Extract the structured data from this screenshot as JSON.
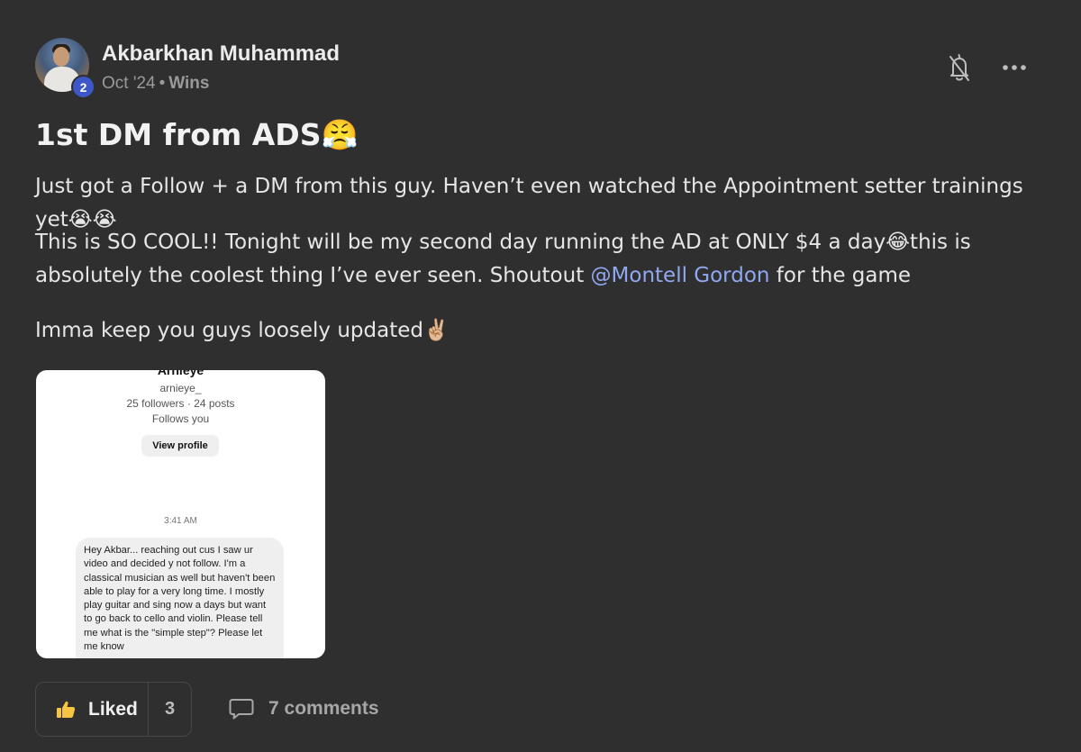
{
  "post": {
    "author": "Akbarkhan Muhammad",
    "level": "2",
    "date": "Oct '24",
    "separator": "•",
    "category": "Wins",
    "title": "1st DM from ADS😤",
    "paragraphs": {
      "p1": "Just got a Follow + a DM from this guy. Haven’t even watched the Appointment setter trainings yet😭😭",
      "p2_before": "This is SO COOL!! Tonight will be my second day running the AD at ONLY $4 a day😂this is absolutely the coolest thing I’ve ever seen. Shoutout ",
      "p2_mention": "@Montell Gordon",
      "p2_after": " for the game",
      "p3": "Imma keep you guys loosely updated✌🏼"
    },
    "icons": {
      "bell": "bell-off-icon",
      "more": "more-horizontal-icon",
      "like": "thumbs-up-icon",
      "comment": "comment-icon"
    }
  },
  "attachment": {
    "name": "Arnieye",
    "handle": "arnieye_",
    "stats": "25 followers · 24 posts",
    "follows": "Follows you",
    "view_profile": "View profile",
    "time": "3:41 AM",
    "message": "Hey Akbar... reaching out cus I saw ur video and decided y not follow. I'm a classical musician as well but haven't been able to play for a very long time. I mostly play guitar and sing now a days but want to go back to cello and violin. Please tell me what is the \"simple step\"? Please let me know"
  },
  "actions": {
    "liked_label": "Liked",
    "like_count": "3",
    "comments_label": "7 comments"
  }
}
